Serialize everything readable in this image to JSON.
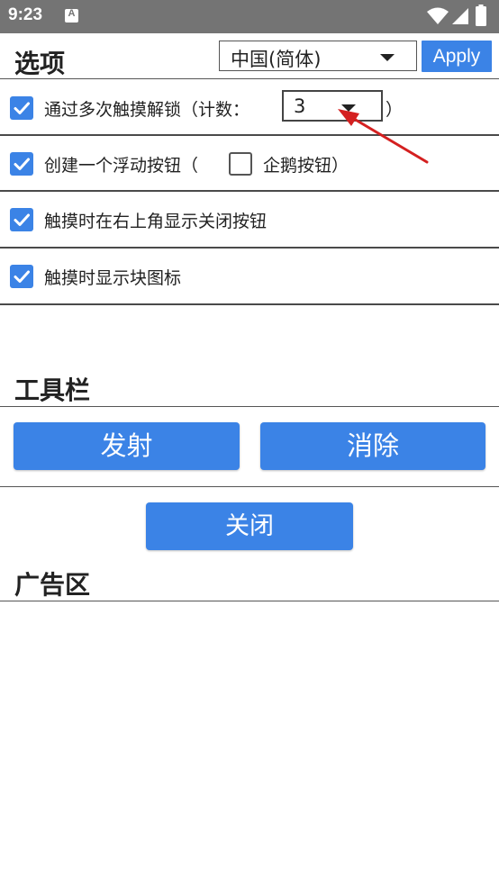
{
  "status_bar": {
    "time": "9:23",
    "notification_glyph": "A",
    "icons": [
      "wifi-icon",
      "signal-icon",
      "battery-icon"
    ]
  },
  "options": {
    "title": "选项",
    "language": {
      "selected": "中国(简体)"
    },
    "apply_label": "Apply",
    "items": [
      {
        "label": "通过多次触摸解锁（计数：",
        "checked": true,
        "count_value": "3",
        "suffix": "）"
      },
      {
        "label": "创建一个浮动按钮（",
        "checked": true,
        "sub_label": "企鹅按钮）",
        "sub_checked": false
      },
      {
        "label": "触摸时在右上角显示关闭按钮",
        "checked": true
      },
      {
        "label": "触摸时显示块图标",
        "checked": true
      }
    ]
  },
  "toolbar": {
    "title": "工具栏",
    "fire_label": "发射",
    "clear_label": "消除",
    "close_label": "关闭"
  },
  "ad_area": {
    "title": "广告区"
  },
  "colors": {
    "accent": "#3b83e6",
    "status_bar": "#747474",
    "annotation_arrow": "#d42020"
  }
}
